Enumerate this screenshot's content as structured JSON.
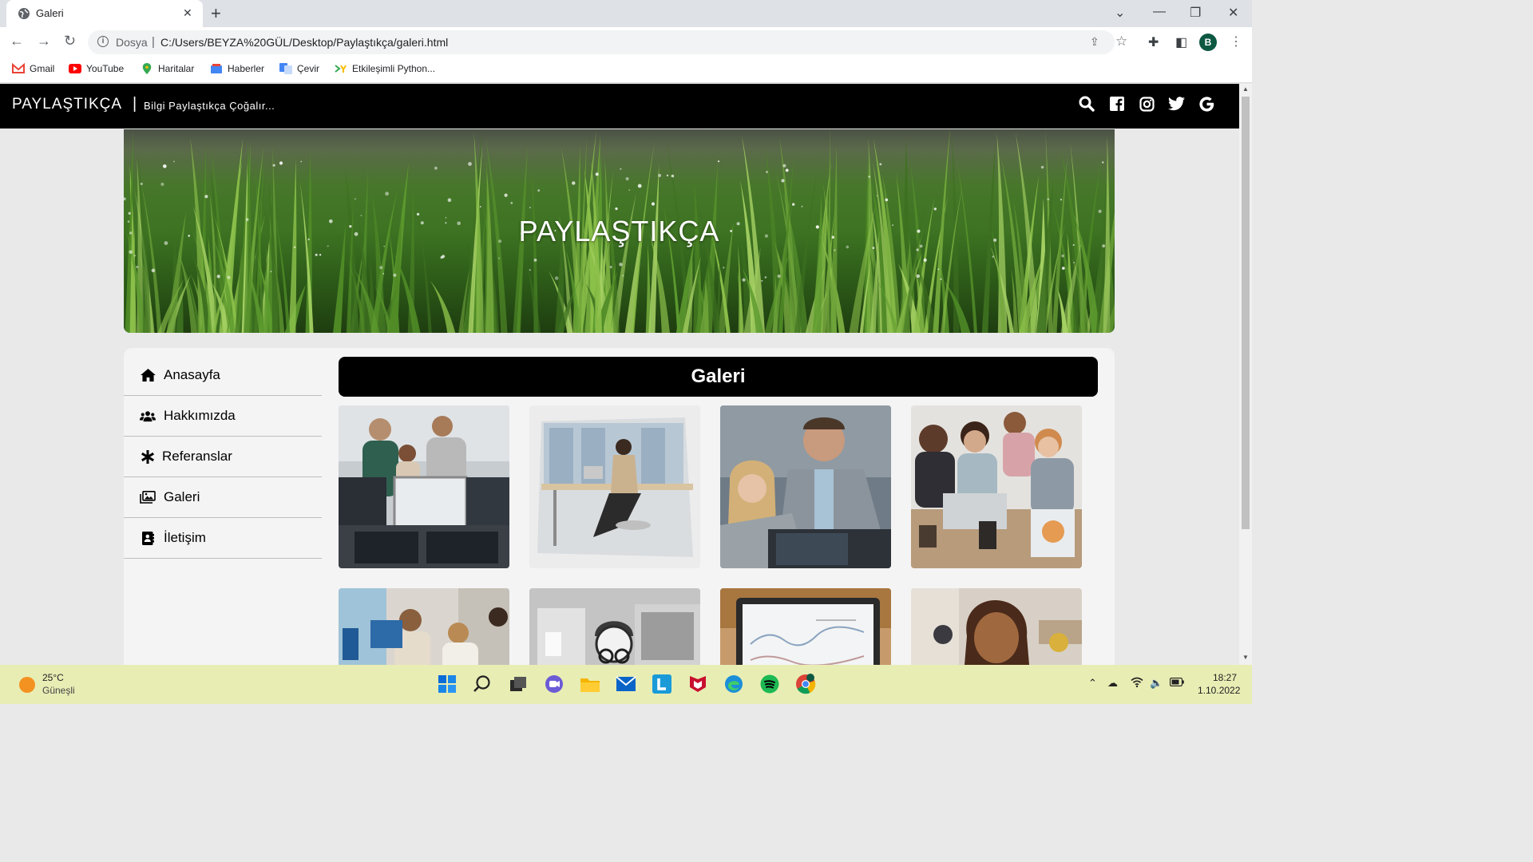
{
  "browser": {
    "tab_title": "Galeri",
    "url_scheme": "Dosya",
    "url": "C:/Users/BEYZA%20GÜL/Desktop/Paylaştıkça/galeri.html",
    "profile_initial": "B",
    "bookmarks": [
      "Gmail",
      "YouTube",
      "Haritalar",
      "Haberler",
      "Çevir",
      "Etkileşimli Python..."
    ]
  },
  "site": {
    "brand": "PAYLAŞTIKÇA",
    "separator": "|",
    "tagline": "Bilgi Paylaştıkça Çoğalır...",
    "hero_title": "PAYLAŞTIKÇA",
    "social_icons": [
      "search-icon",
      "facebook-icon",
      "instagram-icon",
      "twitter-icon",
      "google-icon"
    ]
  },
  "menu": [
    {
      "label": "Anasayfa",
      "icon": "home-icon"
    },
    {
      "label": "Hakkımızda",
      "icon": "users-icon"
    },
    {
      "label": "Referanslar",
      "icon": "asterisk-icon"
    },
    {
      "label": "Galeri",
      "icon": "images-icon"
    },
    {
      "label": "İletişim",
      "icon": "contact-icon"
    }
  ],
  "gallery": {
    "title": "Galeri",
    "photo_count": 8
  },
  "taskbar": {
    "temperature": "25°C",
    "weather": "Güneşli",
    "time": "18:27",
    "date": "1.10.2022"
  }
}
